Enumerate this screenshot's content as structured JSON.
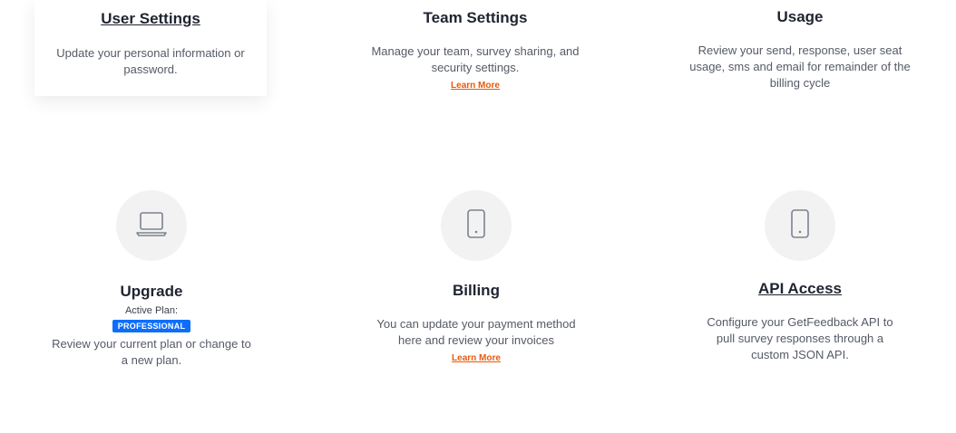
{
  "cards": {
    "user_settings": {
      "title": "User Settings",
      "description": "Update your personal information or password."
    },
    "team_settings": {
      "title": "Team Settings",
      "description": "Manage your team, survey sharing, and security settings.",
      "learn_more": "Learn More"
    },
    "usage": {
      "title": "Usage",
      "description": "Review your send, response, user seat usage,  sms and email for remainder of the billing cycle"
    },
    "upgrade": {
      "title": "Upgrade",
      "active_plan_label": "Active Plan:",
      "plan_badge": "PROFESSIONAL",
      "description": "Review your current plan or change to a new plan.",
      "icon": "laptop-icon"
    },
    "billing": {
      "title": "Billing",
      "description": "You can update your payment method here and review your invoices",
      "learn_more": "Learn More",
      "icon": "phone-icon"
    },
    "api_access": {
      "title": "API Access",
      "description": "Configure your GetFeedback API to pull survey responses through a custom JSON API.",
      "icon": "phone-icon"
    }
  },
  "colors": {
    "link_orange": "#e8590c",
    "badge_blue": "#0d6efd",
    "icon_bg": "#f2f2f3"
  }
}
